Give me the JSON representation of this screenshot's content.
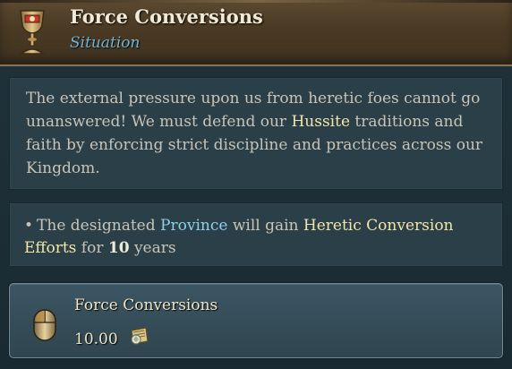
{
  "header": {
    "title": "Force Conversions",
    "subtitle": "Situation",
    "icon": "chalice-icon"
  },
  "description": {
    "part1": "The external pressure upon us from heretic foes cannot go unanswered! We must defend our ",
    "highlight": "Hussite",
    "part2": " traditions and faith by enforcing strict discipline and practices across our Kingdom."
  },
  "effects": {
    "bullet": "•",
    "t1": "The designated ",
    "province": "Province",
    "t2": " will gain ",
    "effect_name": "Heretic Conversion Efforts",
    "t3": " for ",
    "duration": "10",
    "t4": " years"
  },
  "action": {
    "label": "Force Conversions",
    "cost": "10.00",
    "cost_icon": "piety-scroll-icon",
    "click_icon": "mouse-left-click-icon"
  },
  "colors": {
    "header_bg": "#4a3a24",
    "panel_bg": "#2b3f48",
    "title": "#f2ead6",
    "subtitle": "#6fb6d6",
    "highlight_yellow": "#f3e6a8",
    "highlight_blue": "#8fd0ea",
    "body_text": "#c9c4b6"
  }
}
